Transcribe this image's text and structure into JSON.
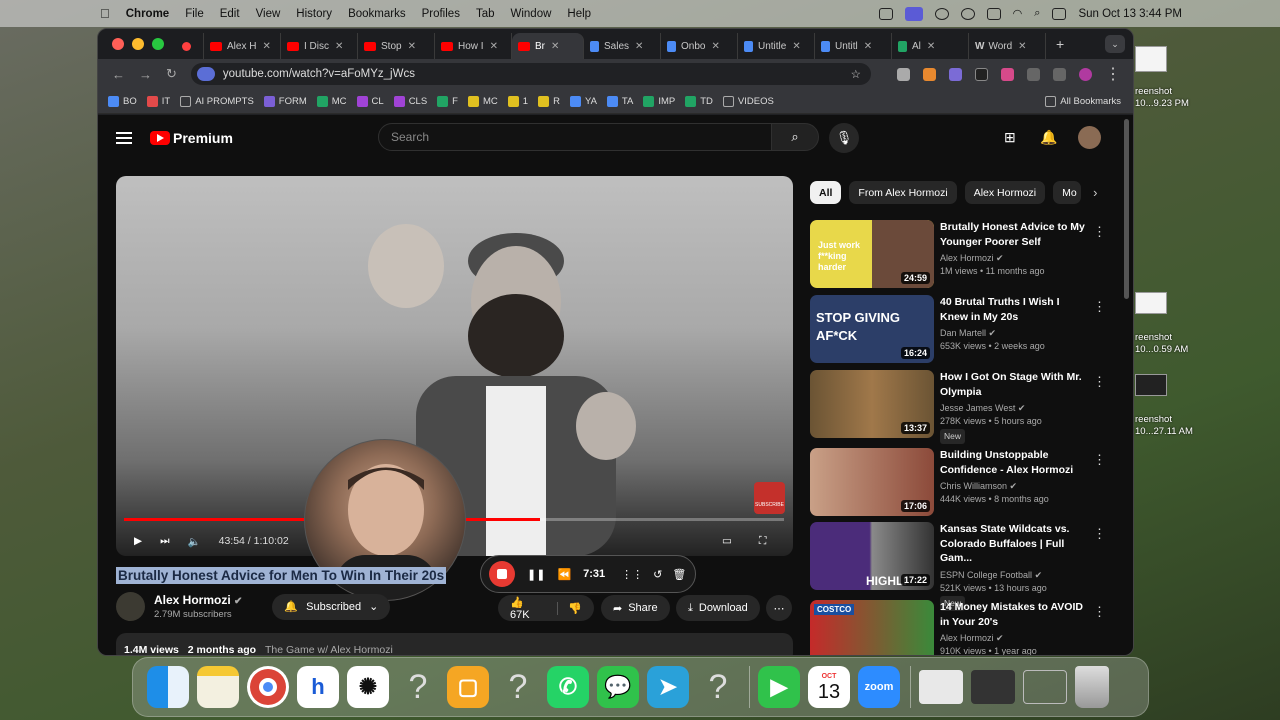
{
  "menubar": {
    "app": "Chrome",
    "items": [
      "File",
      "Edit",
      "View",
      "History",
      "Bookmarks",
      "Profiles",
      "Tab",
      "Window",
      "Help"
    ],
    "clock": "Sun Oct 13  3:44 PM"
  },
  "desktop": {
    "files": [
      {
        "line1": "reenshot",
        "line2": "10...9.23 PM"
      },
      {
        "line1": "reenshot",
        "line2": "10...0.59 AM"
      },
      {
        "line1": "reenshot",
        "line2": "10...27.11 AM"
      }
    ]
  },
  "tabs": [
    {
      "label": "",
      "color": "#ff4040"
    },
    {
      "label": "Alex H",
      "color": "#f00"
    },
    {
      "label": "I Disc",
      "color": "#f00"
    },
    {
      "label": "Stop",
      "color": "#f00"
    },
    {
      "label": "How I",
      "color": "#f00"
    },
    {
      "label": "Br",
      "color": "#f00"
    },
    {
      "label": "Sales",
      "color": "#4c8bf5"
    },
    {
      "label": "Onbo",
      "color": "#4c8bf5"
    },
    {
      "label": "Untitle",
      "color": "#4c8bf5"
    },
    {
      "label": "Untitl",
      "color": "#4c8bf5"
    },
    {
      "label": "Al",
      "color": "#21a464"
    },
    {
      "label": "Word",
      "color": "#ddd"
    }
  ],
  "address": {
    "url": "youtube.com/watch?v=aFoMYz_jWcs"
  },
  "bookmarks": [
    {
      "label": "BO",
      "color": "#4c8bf5"
    },
    {
      "label": "IT",
      "color": "#e34a4a"
    },
    {
      "label": "AI PROMPTS",
      "color": "#888"
    },
    {
      "label": "FORM",
      "color": "#7b5fd6"
    },
    {
      "label": "MC",
      "color": "#21a464"
    },
    {
      "label": "CL",
      "color": "#a043d6"
    },
    {
      "label": "CLS",
      "color": "#a043d6"
    },
    {
      "label": "F",
      "color": "#21a464"
    },
    {
      "label": "MC",
      "color": "#e0c020"
    },
    {
      "label": "1",
      "color": "#e0c020"
    },
    {
      "label": "R",
      "color": "#e0c020"
    },
    {
      "label": "YA",
      "color": "#4c8bf5"
    },
    {
      "label": "TA",
      "color": "#4c8bf5"
    },
    {
      "label": "IMP",
      "color": "#21a464"
    },
    {
      "label": "TD",
      "color": "#21a464"
    },
    {
      "label": "VIDEOS",
      "color": "#888"
    }
  ],
  "all_bookmarks": "All Bookmarks",
  "youtube": {
    "logo": "Premium",
    "search_placeholder": "Search",
    "player": {
      "time": "43:54 / 1:10:02",
      "progress": 0.63,
      "watermark": "SUBSCRIBE"
    },
    "recorder": {
      "time": "7:31"
    },
    "video_title": "Brutally Honest Advice for Men To Win In Their 20s",
    "channel": {
      "name": "Alex Hormozi",
      "subs": "2.79M subscribers"
    },
    "subscribed_label": "Subscribed",
    "likes": "67K",
    "share_label": "Share",
    "download_label": "Download",
    "views": "1.4M views",
    "age": "2 months ago",
    "playlist": "The Game w/ Alex Hormozi",
    "chips": [
      "All",
      "From Alex Hormozi",
      "Alex Hormozi",
      "Mo"
    ],
    "recommendations": [
      {
        "title": "Brutally Honest Advice to My Younger Poorer Self",
        "channel": "Alex Hormozi",
        "meta": "1M views  •  11 months ago",
        "duration": "24:59",
        "new": false,
        "thumb_text": "Just work f**king harder",
        "thumb_color": "#e8d84a"
      },
      {
        "title": "40 Brutal Truths I Wish I Knew in My 20s",
        "channel": "Dan Martell",
        "meta": "653K views  •  2 weeks ago",
        "duration": "16:24",
        "new": false,
        "thumb_text": "STOP GIVING AF*CK",
        "thumb_color": "#2c3e68"
      },
      {
        "title": "How I Got On Stage With Mr. Olympia",
        "channel": "Jesse James West",
        "meta": "278K views  •  5 hours ago",
        "duration": "13:37",
        "new": true,
        "thumb_text": "",
        "thumb_color": "#6b5434"
      },
      {
        "title": "Building Unstoppable Confidence - Alex Hormozi",
        "channel": "Chris Williamson",
        "meta": "444K views  •  8 months ago",
        "duration": "17:06",
        "new": false,
        "thumb_text": "",
        "thumb_color": "#8c4a3a"
      },
      {
        "title": "Kansas State Wildcats vs. Colorado Buffaloes | Full Gam...",
        "channel": "ESPN College Football",
        "meta": "521K views  •  13 hours ago",
        "duration": "17:22",
        "new": true,
        "thumb_text": "HIGHLI",
        "thumb_color": "#4b2c7a"
      },
      {
        "title": "14 Money Mistakes to AVOID in Your 20's",
        "channel": "Alex Hormozi",
        "meta": "910K views  •  1 year ago",
        "duration": "",
        "new": false,
        "thumb_text": "COSTCO",
        "thumb_color": "#c52a2a"
      }
    ],
    "new_label": "New"
  },
  "dock": {
    "calendar": {
      "month": "OCT",
      "day": "13"
    },
    "zoom_label": "zoom"
  }
}
